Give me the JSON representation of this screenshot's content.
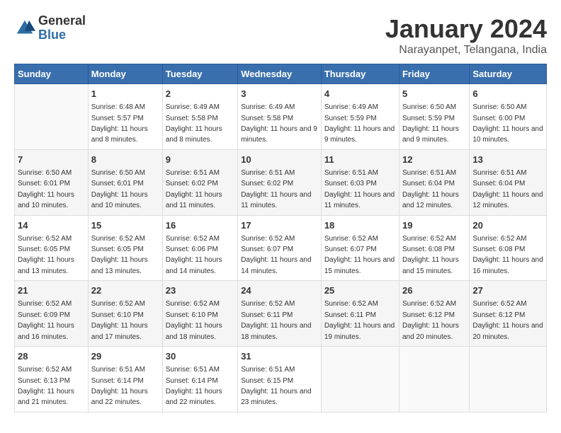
{
  "logo": {
    "general": "General",
    "blue": "Blue"
  },
  "title": "January 2024",
  "subtitle": "Narayanpet, Telangana, India",
  "days_of_week": [
    "Sunday",
    "Monday",
    "Tuesday",
    "Wednesday",
    "Thursday",
    "Friday",
    "Saturday"
  ],
  "weeks": [
    [
      {
        "day": "",
        "sunrise": "",
        "sunset": "",
        "daylight": ""
      },
      {
        "day": "1",
        "sunrise": "Sunrise: 6:48 AM",
        "sunset": "Sunset: 5:57 PM",
        "daylight": "Daylight: 11 hours and 8 minutes."
      },
      {
        "day": "2",
        "sunrise": "Sunrise: 6:49 AM",
        "sunset": "Sunset: 5:58 PM",
        "daylight": "Daylight: 11 hours and 8 minutes."
      },
      {
        "day": "3",
        "sunrise": "Sunrise: 6:49 AM",
        "sunset": "Sunset: 5:58 PM",
        "daylight": "Daylight: 11 hours and 9 minutes."
      },
      {
        "day": "4",
        "sunrise": "Sunrise: 6:49 AM",
        "sunset": "Sunset: 5:59 PM",
        "daylight": "Daylight: 11 hours and 9 minutes."
      },
      {
        "day": "5",
        "sunrise": "Sunrise: 6:50 AM",
        "sunset": "Sunset: 5:59 PM",
        "daylight": "Daylight: 11 hours and 9 minutes."
      },
      {
        "day": "6",
        "sunrise": "Sunrise: 6:50 AM",
        "sunset": "Sunset: 6:00 PM",
        "daylight": "Daylight: 11 hours and 10 minutes."
      }
    ],
    [
      {
        "day": "7",
        "sunrise": "Sunrise: 6:50 AM",
        "sunset": "Sunset: 6:01 PM",
        "daylight": "Daylight: 11 hours and 10 minutes."
      },
      {
        "day": "8",
        "sunrise": "Sunrise: 6:50 AM",
        "sunset": "Sunset: 6:01 PM",
        "daylight": "Daylight: 11 hours and 10 minutes."
      },
      {
        "day": "9",
        "sunrise": "Sunrise: 6:51 AM",
        "sunset": "Sunset: 6:02 PM",
        "daylight": "Daylight: 11 hours and 11 minutes."
      },
      {
        "day": "10",
        "sunrise": "Sunrise: 6:51 AM",
        "sunset": "Sunset: 6:02 PM",
        "daylight": "Daylight: 11 hours and 11 minutes."
      },
      {
        "day": "11",
        "sunrise": "Sunrise: 6:51 AM",
        "sunset": "Sunset: 6:03 PM",
        "daylight": "Daylight: 11 hours and 11 minutes."
      },
      {
        "day": "12",
        "sunrise": "Sunrise: 6:51 AM",
        "sunset": "Sunset: 6:04 PM",
        "daylight": "Daylight: 11 hours and 12 minutes."
      },
      {
        "day": "13",
        "sunrise": "Sunrise: 6:51 AM",
        "sunset": "Sunset: 6:04 PM",
        "daylight": "Daylight: 11 hours and 12 minutes."
      }
    ],
    [
      {
        "day": "14",
        "sunrise": "Sunrise: 6:52 AM",
        "sunset": "Sunset: 6:05 PM",
        "daylight": "Daylight: 11 hours and 13 minutes."
      },
      {
        "day": "15",
        "sunrise": "Sunrise: 6:52 AM",
        "sunset": "Sunset: 6:05 PM",
        "daylight": "Daylight: 11 hours and 13 minutes."
      },
      {
        "day": "16",
        "sunrise": "Sunrise: 6:52 AM",
        "sunset": "Sunset: 6:06 PM",
        "daylight": "Daylight: 11 hours and 14 minutes."
      },
      {
        "day": "17",
        "sunrise": "Sunrise: 6:52 AM",
        "sunset": "Sunset: 6:07 PM",
        "daylight": "Daylight: 11 hours and 14 minutes."
      },
      {
        "day": "18",
        "sunrise": "Sunrise: 6:52 AM",
        "sunset": "Sunset: 6:07 PM",
        "daylight": "Daylight: 11 hours and 15 minutes."
      },
      {
        "day": "19",
        "sunrise": "Sunrise: 6:52 AM",
        "sunset": "Sunset: 6:08 PM",
        "daylight": "Daylight: 11 hours and 15 minutes."
      },
      {
        "day": "20",
        "sunrise": "Sunrise: 6:52 AM",
        "sunset": "Sunset: 6:08 PM",
        "daylight": "Daylight: 11 hours and 16 minutes."
      }
    ],
    [
      {
        "day": "21",
        "sunrise": "Sunrise: 6:52 AM",
        "sunset": "Sunset: 6:09 PM",
        "daylight": "Daylight: 11 hours and 16 minutes."
      },
      {
        "day": "22",
        "sunrise": "Sunrise: 6:52 AM",
        "sunset": "Sunset: 6:10 PM",
        "daylight": "Daylight: 11 hours and 17 minutes."
      },
      {
        "day": "23",
        "sunrise": "Sunrise: 6:52 AM",
        "sunset": "Sunset: 6:10 PM",
        "daylight": "Daylight: 11 hours and 18 minutes."
      },
      {
        "day": "24",
        "sunrise": "Sunrise: 6:52 AM",
        "sunset": "Sunset: 6:11 PM",
        "daylight": "Daylight: 11 hours and 18 minutes."
      },
      {
        "day": "25",
        "sunrise": "Sunrise: 6:52 AM",
        "sunset": "Sunset: 6:11 PM",
        "daylight": "Daylight: 11 hours and 19 minutes."
      },
      {
        "day": "26",
        "sunrise": "Sunrise: 6:52 AM",
        "sunset": "Sunset: 6:12 PM",
        "daylight": "Daylight: 11 hours and 20 minutes."
      },
      {
        "day": "27",
        "sunrise": "Sunrise: 6:52 AM",
        "sunset": "Sunset: 6:12 PM",
        "daylight": "Daylight: 11 hours and 20 minutes."
      }
    ],
    [
      {
        "day": "28",
        "sunrise": "Sunrise: 6:52 AM",
        "sunset": "Sunset: 6:13 PM",
        "daylight": "Daylight: 11 hours and 21 minutes."
      },
      {
        "day": "29",
        "sunrise": "Sunrise: 6:51 AM",
        "sunset": "Sunset: 6:14 PM",
        "daylight": "Daylight: 11 hours and 22 minutes."
      },
      {
        "day": "30",
        "sunrise": "Sunrise: 6:51 AM",
        "sunset": "Sunset: 6:14 PM",
        "daylight": "Daylight: 11 hours and 22 minutes."
      },
      {
        "day": "31",
        "sunrise": "Sunrise: 6:51 AM",
        "sunset": "Sunset: 6:15 PM",
        "daylight": "Daylight: 11 hours and 23 minutes."
      },
      {
        "day": "",
        "sunrise": "",
        "sunset": "",
        "daylight": ""
      },
      {
        "day": "",
        "sunrise": "",
        "sunset": "",
        "daylight": ""
      },
      {
        "day": "",
        "sunrise": "",
        "sunset": "",
        "daylight": ""
      }
    ]
  ]
}
